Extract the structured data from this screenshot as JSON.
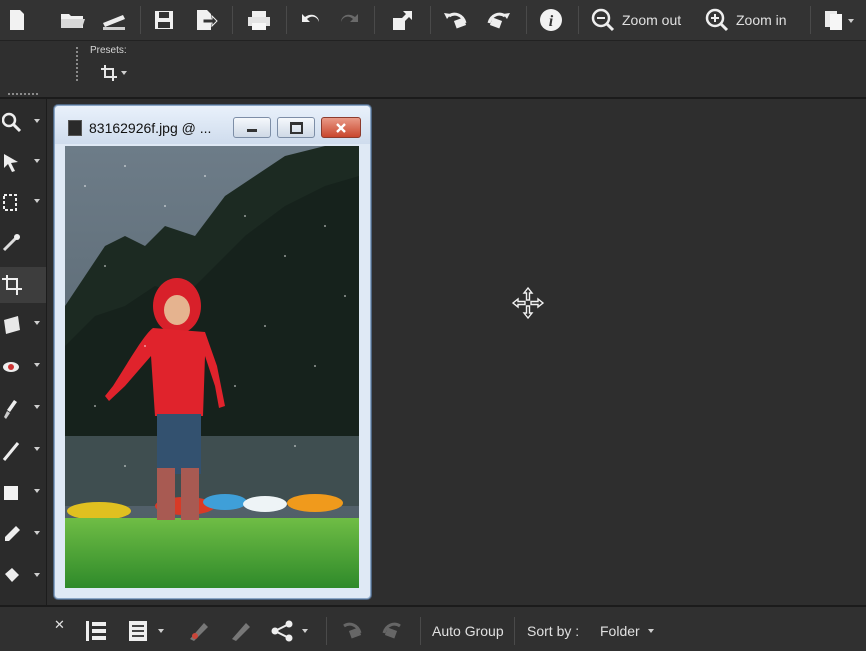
{
  "toolbar": {
    "zoom_out_label": "Zoom out",
    "zoom_in_label": "Zoom in",
    "icons": [
      "new-icon",
      "open-icon",
      "scan-icon",
      "save-icon",
      "export-icon",
      "print-icon",
      "undo-icon",
      "redo-icon",
      "resize-icon",
      "rotate-left-icon",
      "rotate-right-icon",
      "info-icon",
      "zoom-out-icon",
      "zoom-in-icon",
      "copy-icon"
    ]
  },
  "options": {
    "presets_label": "Presets:",
    "crop_icon": "crop-icon"
  },
  "document": {
    "title": "83162926f.jpg @ ...",
    "image_description_icon": "photo"
  },
  "bottombar": {
    "auto_group_label": "Auto Group",
    "sort_by_label": "Sort by :",
    "sort_value": "Folder"
  },
  "colors": {
    "toolbar_bg": "#333333",
    "workspace_bg": "#2e2e2e",
    "window_frame": "#dfe9f5",
    "close_red": "#c9462d"
  }
}
